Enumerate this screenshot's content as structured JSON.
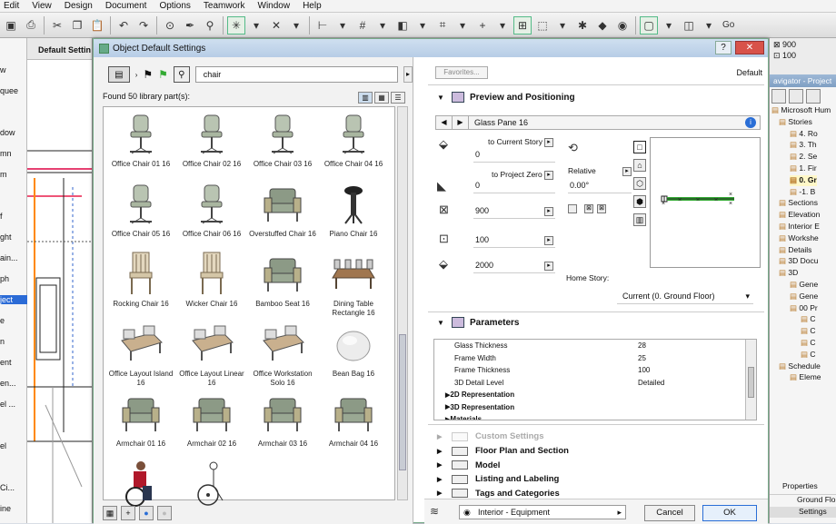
{
  "menu": [
    "Edit",
    "View",
    "Design",
    "Document",
    "Options",
    "Teamwork",
    "Window",
    "Help"
  ],
  "toolbar": {
    "go_label": "Go"
  },
  "left_strip": [
    "w",
    "quee",
    "",
    "dow",
    "mn",
    "m",
    "",
    "f",
    "ght",
    "ain...",
    "ph",
    "ject",
    "e",
    "n",
    "ent",
    "en...",
    "el ...",
    "",
    "el",
    "",
    "Ci...",
    "ine"
  ],
  "plan_tab": "Default Settin",
  "dialog": {
    "title": "Object Default Settings",
    "search_value": "chair",
    "found_text": "Found 50 library part(s):",
    "items": [
      {
        "name": "Office Chair 01 16",
        "kind": "office"
      },
      {
        "name": "Office Chair 02 16",
        "kind": "office"
      },
      {
        "name": "Office Chair 03 16",
        "kind": "office"
      },
      {
        "name": "Office Chair 04 16",
        "kind": "office"
      },
      {
        "name": "Office Chair 05 16",
        "kind": "office"
      },
      {
        "name": "Office Chair 06 16",
        "kind": "office"
      },
      {
        "name": "Overstuffed Chair 16",
        "kind": "arm"
      },
      {
        "name": "Piano Chair 16",
        "kind": "stool"
      },
      {
        "name": "Rocking Chair 16",
        "kind": "wood"
      },
      {
        "name": "Wicker Chair 16",
        "kind": "wood"
      },
      {
        "name": "Bamboo Seat 16",
        "kind": "arm"
      },
      {
        "name": "Dining Table Rectangle 16",
        "kind": "table"
      },
      {
        "name": "Office Layout Island 16",
        "kind": "desk"
      },
      {
        "name": "Office Layout Linear 16",
        "kind": "desk"
      },
      {
        "name": "Office Workstation Solo 16",
        "kind": "desk"
      },
      {
        "name": "Bean Bag 16",
        "kind": "bag"
      },
      {
        "name": "Armchair 01 16",
        "kind": "arm"
      },
      {
        "name": "Armchair 02 16",
        "kind": "arm"
      },
      {
        "name": "Armchair 03 16",
        "kind": "arm"
      },
      {
        "name": "Armchair 04 16",
        "kind": "arm"
      },
      {
        "name": "",
        "kind": "wheel"
      },
      {
        "name": "",
        "kind": "wheel2"
      }
    ],
    "favorites_label": "Favorites...",
    "default_label": "Default",
    "preview_section": "Preview and Positioning",
    "pane_name": "Glass Pane 16",
    "to_current_story": "to Current Story",
    "to_current_story_value": "0",
    "to_project_zero": "to Project Zero",
    "to_project_zero_value": "0",
    "relative_label": "Relative",
    "angle_value": "0.00°",
    "dim_x": "900",
    "dim_y": "100",
    "dim_z": "2000",
    "home_story_label": "Home Story:",
    "home_story_value": "Current (0. Ground Floor)",
    "parameters_section": "Parameters",
    "parameters": [
      {
        "key": "Glass Thickness",
        "value": "28",
        "bold": false
      },
      {
        "key": "Frame Width",
        "value": "25",
        "bold": false
      },
      {
        "key": "Frame Thickness",
        "value": "100",
        "bold": false
      },
      {
        "key": "3D Detail Level",
        "value": "Detailed",
        "bold": false
      },
      {
        "key": "2D Representation",
        "value": "",
        "bold": true
      },
      {
        "key": "3D Representation",
        "value": "",
        "bold": true
      },
      {
        "key": "Materials",
        "value": "",
        "bold": true
      }
    ],
    "custom_settings": "Custom Settings",
    "sections": [
      "Floor Plan and Section",
      "Model",
      "Listing and Labeling",
      "Tags and Categories"
    ],
    "layer_value": "Interior - Equipment",
    "cancel_label": "Cancel",
    "ok_label": "OK"
  },
  "right": {
    "coord_x": "900",
    "coord_y": "100",
    "nav_header": "avigator - Project",
    "tree": [
      {
        "label": "Microsoft Hum",
        "bold": false,
        "hl": false
      },
      {
        "label": "Stories",
        "bold": false,
        "hl": false
      },
      {
        "label": "4. Ro",
        "bold": false,
        "hl": false
      },
      {
        "label": "3. Th",
        "bold": false,
        "hl": false
      },
      {
        "label": "2. Se",
        "bold": false,
        "hl": false
      },
      {
        "label": "1. Fir",
        "bold": false,
        "hl": false
      },
      {
        "label": "0. Gr",
        "bold": true,
        "hl": true
      },
      {
        "label": "-1. B",
        "bold": false,
        "hl": false
      },
      {
        "label": "Sections",
        "bold": false,
        "hl": false
      },
      {
        "label": "Elevation",
        "bold": false,
        "hl": false
      },
      {
        "label": "Interior E",
        "bold": false,
        "hl": false
      },
      {
        "label": "Workshe",
        "bold": false,
        "hl": false
      },
      {
        "label": "Details",
        "bold": false,
        "hl": false
      },
      {
        "label": "3D Docu",
        "bold": false,
        "hl": false
      },
      {
        "label": "3D",
        "bold": false,
        "hl": false
      },
      {
        "label": "Gene",
        "bold": false,
        "hl": false
      },
      {
        "label": "Gene",
        "bold": false,
        "hl": false
      },
      {
        "label": "00 Pr",
        "bold": false,
        "hl": false
      },
      {
        "label": "C",
        "bold": false,
        "hl": false
      },
      {
        "label": "C",
        "bold": false,
        "hl": false
      },
      {
        "label": "C",
        "bold": false,
        "hl": false
      },
      {
        "label": "C",
        "bold": false,
        "hl": false
      },
      {
        "label": "Schedule",
        "bold": false,
        "hl": false
      },
      {
        "label": "Eleme",
        "bold": false,
        "hl": false
      }
    ],
    "properties_label": "Properties",
    "ground_floor_label": "Ground Flo",
    "settings_label": "Settings"
  }
}
